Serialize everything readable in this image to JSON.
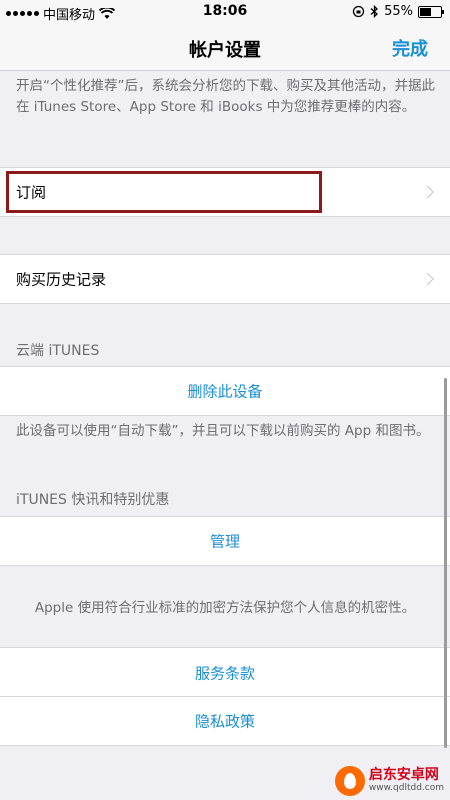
{
  "status_bar": {
    "carrier": "中国移动",
    "time": "18:06",
    "battery_text": "55%",
    "battery_level": 0.55,
    "icons": [
      "signal-icon",
      "wifi-icon",
      "orientation-lock-icon",
      "bluetooth-icon",
      "battery-icon"
    ]
  },
  "nav": {
    "title": "帐户设置",
    "done": "完成"
  },
  "personalization": {
    "description": "开启“个性化推荐”后，系统会分析您的下载、购买及其他活动，并据此在 iTunes Store、App Store 和 iBooks 中为您推荐更棒的内容。"
  },
  "rows": {
    "subscriptions": "订阅",
    "purchase_history": "购买历史记录"
  },
  "cloud": {
    "header": "云端 iTUNES",
    "remove_device": "删除此设备",
    "description": "此设备可以使用“自动下载”，并且可以下载以前购买的 App 和图书。"
  },
  "news": {
    "header": "iTUNES 快讯和特别优惠",
    "manage": "管理"
  },
  "privacy": {
    "description": "Apple 使用符合行业标准的加密方法保护您个人信息的机密性。",
    "terms": "服务条款",
    "policy": "隐私政策"
  },
  "watermark": {
    "name": "启东安卓网",
    "url": "www.qdltdd.com"
  },
  "colors": {
    "accent": "#1a8fd3",
    "highlight": "#8b1a1a",
    "background": "#efeff4"
  }
}
